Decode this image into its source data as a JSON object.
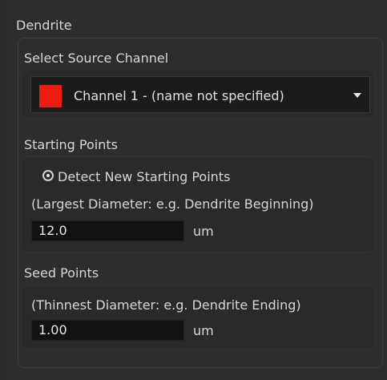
{
  "panel": {
    "title": "Dendrite"
  },
  "source_channel": {
    "label": "Select Source Channel",
    "selected": "Channel 1 - (name not specified)",
    "swatch_color": "#ee1b11",
    "dropdown_icon": "chevron-down-icon"
  },
  "starting_points": {
    "label": "Starting Points",
    "radio_label": "Detect New Starting Points",
    "radio_selected": true,
    "hint": "(Largest Diameter: e.g. Dendrite Beginning)",
    "value": "12.0",
    "unit": "um"
  },
  "seed_points": {
    "label": "Seed Points",
    "hint": "(Thinnest Diameter: e.g. Dendrite Ending)",
    "value": "1.00",
    "unit": "um"
  }
}
